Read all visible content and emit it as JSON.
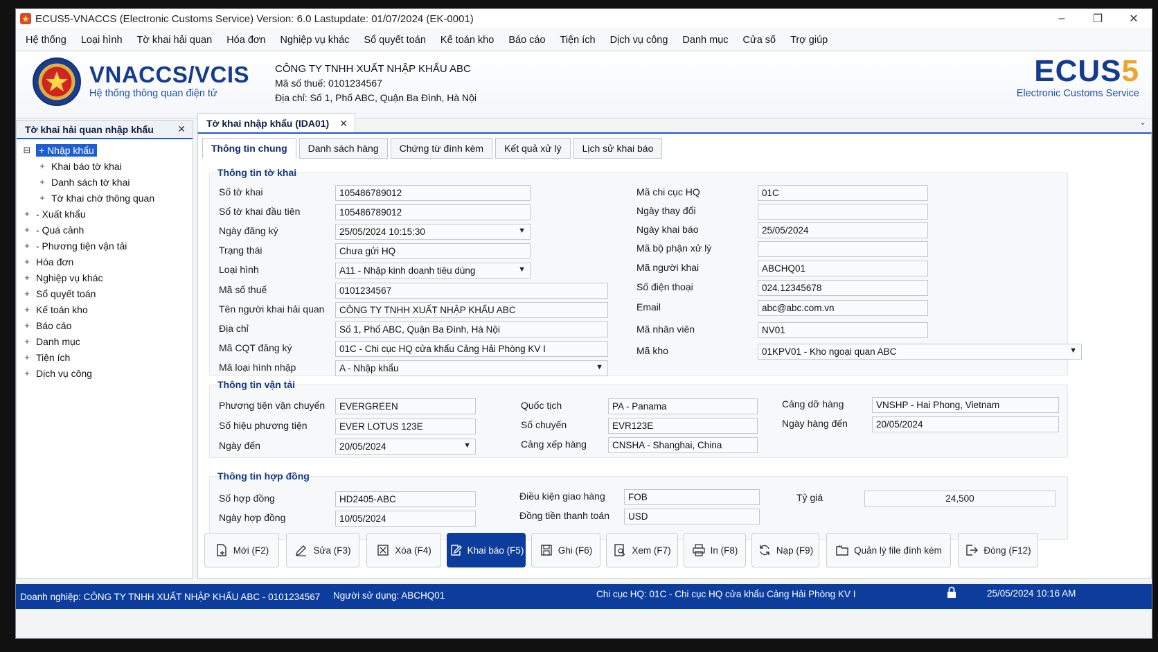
{
  "window": {
    "title": "ECUS5-VNACCS (Electronic Customs Service) Version: 6.0 Lastupdate: 01/07/2024 (EK-0001)",
    "minimize": "–",
    "restore": "❐",
    "close": "✕"
  },
  "menu": [
    "Hệ thống",
    "Loại hình",
    "Tờ khai hải quan",
    "Hóa đơn",
    "Nghiệp vụ khác",
    "Sổ quyết toán",
    "Kế toán kho",
    "Báo cáo",
    "Tiện ích",
    "Dịch vụ công",
    "Danh mục",
    "Cửa số",
    "Trợ giúp"
  ],
  "header": {
    "brand_title": "VNACCS/VCIS",
    "brand_subtitle": "Hệ thống thông quan điện tử",
    "company_name": "CÔNG TY TNHH XUẤT NHẬP KHẨU ABC",
    "tax_code": "Mã số thuế: 0101234567",
    "address": "Địa chỉ: Số 1, Phố ABC, Quận Ba Đình, Hà Nội",
    "ecus_part1": "ECUS",
    "ecus_part2": "5",
    "ecus_subtitle": "Electronic Customs Service",
    "accent_blue": "#153b8f",
    "accent_orange": "#f0a22a"
  },
  "sidebar": {
    "title": "Tờ khai hải quan nhập khẩu",
    "close": "✕",
    "items": [
      {
        "label": "+ Nhập khẩu",
        "toggle": "⊟"
      },
      {
        "label": "Khai báo tờ khai",
        "toggle": "+"
      },
      {
        "label": "Danh sách tờ khai",
        "toggle": "+"
      },
      {
        "label": "Tờ khai chờ thông quan",
        "toggle": "+"
      },
      {
        "label": "- Xuất khẩu",
        "toggle": "+"
      },
      {
        "label": "- Quá cảnh",
        "toggle": "+"
      },
      {
        "label": "- Phương tiện vận tải",
        "toggle": "+"
      },
      {
        "label": "Hóa đơn",
        "toggle": "+"
      },
      {
        "label": "Nghiệp vụ khác",
        "toggle": "+"
      },
      {
        "label": "Sổ quyết toán",
        "toggle": "+"
      },
      {
        "label": "Kế toán kho",
        "toggle": "+"
      },
      {
        "label": "Báo cáo",
        "toggle": "+"
      },
      {
        "label": "Danh mục",
        "toggle": "+"
      },
      {
        "label": "Tiện ích",
        "toggle": "+"
      },
      {
        "label": "Dịch vụ công",
        "toggle": "+"
      }
    ]
  },
  "doc_tab": {
    "label": "Tờ khai nhập khẩu (IDA01)",
    "close": "✕",
    "chevron": "⌄"
  },
  "tabs": [
    "Thông tin chung",
    "Danh sách hàng",
    "Chứng từ đính kèm",
    "Kết quả xử lý",
    "Lịch sử khai báo"
  ],
  "declaration": {
    "title": "Thông tin tờ khai",
    "so_to_khai": {
      "label": "Số tờ khai",
      "value": "105486789012"
    },
    "so_to_khai_dau_tien": {
      "label": "Số tờ khai đầu tiên",
      "value": "105486789012"
    },
    "ngay_dang_ky": {
      "label": "Ngày đăng ký",
      "value": "25/05/2024 10:15:30"
    },
    "trang_thai": {
      "label": "Trạng thái",
      "value": "Chưa gửi HQ"
    },
    "loai_hinh": {
      "label": "Loại hình",
      "value": "A11 - Nhập kinh doanh tiêu dùng"
    },
    "ma_so_thue": {
      "label": "Mã số thuế",
      "value": "0101234567"
    },
    "ten_nguoi_khai": {
      "label": "Tên người khai hải quan",
      "value": "CÔNG TY TNHH XUẤT NHẬP KHẨU ABC"
    },
    "dia_chi": {
      "label": "Địa chỉ",
      "value": "Số 1, Phố ABC, Quận Ba Đình, Hà Nội"
    },
    "ma_cqt": {
      "label": "Mã CQT đăng ký",
      "value": "01C - Chi cục HQ cửa khẩu Cảng Hải Phòng KV I"
    },
    "ma_loai_hinh_nhap": {
      "label": "Mã loại hình nhập",
      "value": "A - Nhập khẩu"
    },
    "ma_chi_cuc": {
      "label": "Mã chi cục HQ",
      "value": "01C"
    },
    "ngay_thay_doi": {
      "label": "Ngày thay đổi",
      "value": ""
    },
    "ngay_khai_bao": {
      "label": "Ngày khai báo",
      "value": "25/05/2024"
    },
    "ma_bo_phan": {
      "label": "Mã bộ phận xử lý",
      "value": ""
    },
    "ma_nguoi_khai": {
      "label": "Mã người khai",
      "value": "ABCHQ01"
    },
    "so_dien_thoai": {
      "label": "Số điện thoại",
      "value": "024.12345678"
    },
    "email": {
      "label": "Email",
      "value": "abc@abc.com.vn"
    },
    "ma_nhan_vien": {
      "label": "Mã nhân viên",
      "value": "NV01"
    },
    "ma_kho": {
      "label": "Mã kho",
      "value": "01KPV01 - Kho ngoại quan ABC"
    }
  },
  "transport": {
    "title": "Thông tin vận tải",
    "phuong_tien": {
      "label": "Phương tiện vận chuyển",
      "value": "EVERGREEN"
    },
    "so_hieu": {
      "label": "Số hiệu phương tiện",
      "value": "EVER LOTUS 123E"
    },
    "ngay_den": {
      "label": "Ngày đến",
      "value": "20/05/2024"
    },
    "quoc_tich": {
      "label": "Quốc tịch",
      "value": "PA - Panama"
    },
    "so_chuyen": {
      "label": "Số chuyến",
      "value": "EVR123E"
    },
    "cang_xep": {
      "label": "Cảng xếp hàng",
      "value": "CNSHA - Shanghai, China"
    },
    "cang_do": {
      "label": "Cảng dỡ hàng",
      "value": "VNSHP - Hai Phong, Vietnam"
    },
    "ngay_hang_den": {
      "label": "Ngày hàng đến",
      "value": "20/05/2024"
    }
  },
  "contract": {
    "title": "Thông tin hợp đồng",
    "so_hop_dong": {
      "label": "Số hợp đồng",
      "value": "HD2405-ABC"
    },
    "ngay_hop_dong": {
      "label": "Ngày hợp đồng",
      "value": "10/05/2024"
    },
    "dieu_kien": {
      "label": "Điều kiện giao hàng",
      "value": "FOB"
    },
    "dong_tien": {
      "label": "Đồng tiền thanh toán",
      "value": "USD"
    },
    "ty_gia": {
      "label": "Tỷ giá",
      "value": "24,500"
    }
  },
  "actions": [
    {
      "label": "Mới (F2)",
      "icon": "new-document-icon"
    },
    {
      "label": "Sửa (F3)",
      "icon": "edit-pencil-icon"
    },
    {
      "label": "Xóa (F4)",
      "icon": "delete-box-icon"
    },
    {
      "label": "Khai báo (F5)",
      "icon": "declare-edit-icon"
    },
    {
      "label": "Ghi (F6)",
      "icon": "save-disk-icon"
    },
    {
      "label": "Xem (F7)",
      "icon": "view-document-icon"
    },
    {
      "label": "In (F8)",
      "icon": "printer-icon"
    },
    {
      "label": "Nạp (F9)",
      "icon": "reload-icon"
    },
    {
      "label": "Quản lý file đính kèm",
      "icon": "attachment-folder-icon"
    },
    {
      "label": "Đóng (F12)",
      "icon": "exit-icon"
    }
  ],
  "status": {
    "enterprise": "Doanh nghiệp:  CÔNG TY TNHH XUẤT NHẬP KHẨU ABC - 0101234567",
    "user": "Người sử dụng:  ABCHQ01",
    "branch": "Chi cục HQ:   01C - Chi cục HQ cửa khẩu Cảng Hải Phòng KV I",
    "datetime": "25/05/2024 10:16 AM"
  }
}
